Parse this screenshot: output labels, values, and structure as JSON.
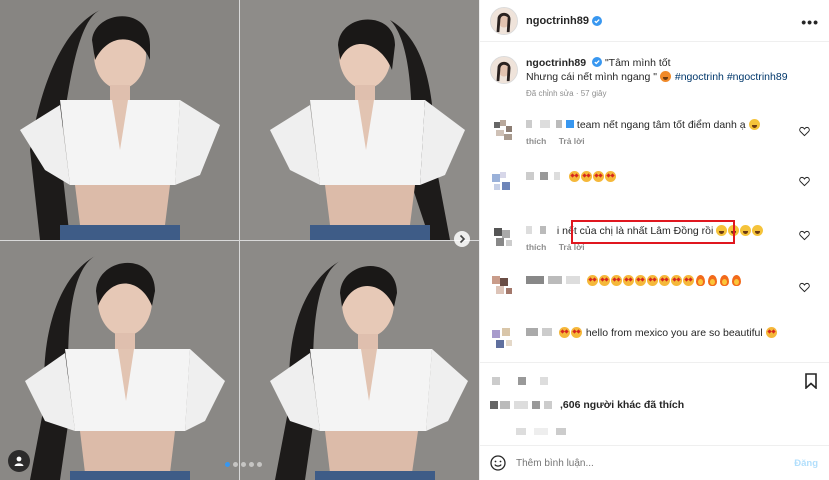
{
  "post": {
    "username": "ngoctrinh89",
    "caption_quote": "\"Tâm mình tốt",
    "caption_line2": "Nhưng cái nết mình ngang \"",
    "hashtag1": "#ngoctrinh",
    "hashtag2": "#ngoctrinh89",
    "edited_meta": "Đã chỉnh sửa · 57 giây",
    "more_label": "•••",
    "carousel_slides": 5,
    "carousel_active": 1
  },
  "comments": [
    {
      "text": "team nết ngang tâm tốt điểm danh ạ",
      "time": "",
      "like_label": "thích",
      "reply_label": "Trả lời"
    },
    {
      "text": "",
      "emojis": [
        "star",
        "star",
        "star",
        "star"
      ]
    },
    {
      "text": "i nết của chị là nhất Lâm Đồng rồi",
      "emojis": [
        "laugh",
        "laugh",
        "laugh",
        "laugh"
      ],
      "like_label": "thích",
      "reply_label": "Trả lời"
    },
    {
      "text": "",
      "emojis": [
        "star",
        "star",
        "star",
        "star",
        "star",
        "star",
        "star",
        "star",
        "star",
        "fire",
        "fire",
        "fire",
        "fire"
      ]
    },
    {
      "text": "hello from mexico you are so beautiful",
      "emojis_before": [
        "star",
        "star"
      ],
      "emojis_after": [
        "star"
      ]
    }
  ],
  "footer": {
    "likes_text": ",606 người khác đã thích",
    "comment_placeholder": "Thêm bình luận...",
    "post_label": "Đăng"
  },
  "colors": {
    "highlight": "#e0171f",
    "verified": "#3897f0",
    "hashtag": "#00376b"
  },
  "icons": [
    "chevron-right-icon",
    "user-tag-icon",
    "verified-icon",
    "more-icon",
    "heart-icon",
    "bookmark-icon",
    "smile-icon"
  ]
}
